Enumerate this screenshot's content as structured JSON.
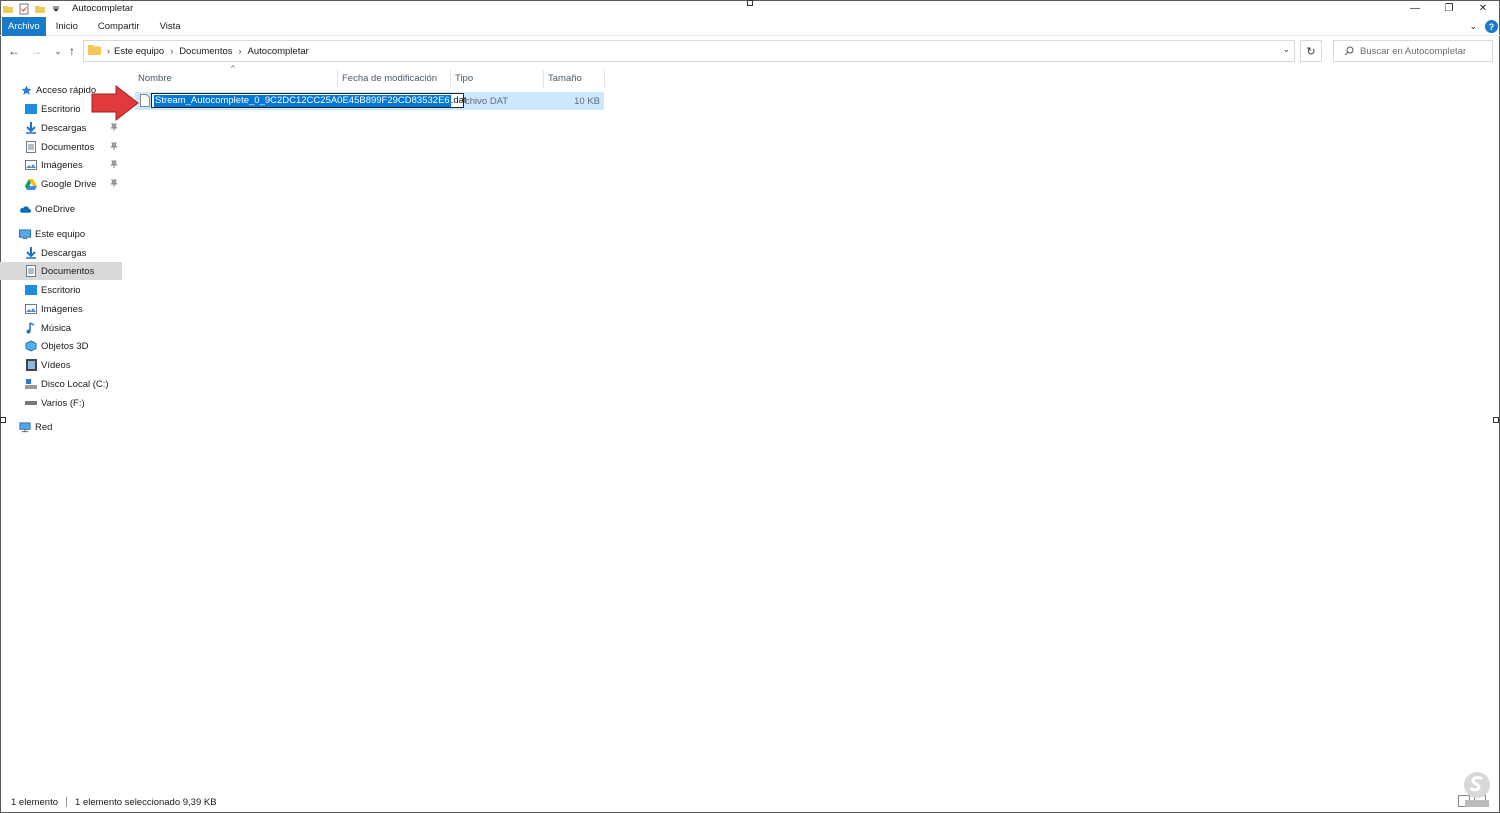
{
  "window": {
    "title": "Autocompletar",
    "controls": {
      "minimize": "—",
      "restore": "❐",
      "close": "✕"
    }
  },
  "ribbon": {
    "tabs": [
      "Archivo",
      "Inicio",
      "Compartir",
      "Vista"
    ],
    "help": "?"
  },
  "address": {
    "crumbs": [
      "Este equipo",
      "Documentos",
      "Autocompletar"
    ]
  },
  "search": {
    "placeholder": "Buscar en Autocompletar"
  },
  "nav_pane": {
    "quick_access": {
      "label": "Acceso rápido",
      "items": [
        "Escritorio",
        "Descargas",
        "Documentos",
        "Imágenes",
        "Google Drive"
      ]
    },
    "onedrive": "OneDrive",
    "this_pc": {
      "label": "Este equipo",
      "items": [
        "Descargas",
        "Documentos",
        "Escritorio",
        "Imágenes",
        "Música",
        "Objetos 3D",
        "Vídeos",
        "Disco Local (C:)",
        "Varios (F:)"
      ]
    },
    "network": "Red"
  },
  "columns": [
    "Nombre",
    "Fecha de modificación",
    "Tipo",
    "Tamaño"
  ],
  "file": {
    "name_selected": "Stream_Autocomplete_0_9C2DC12CC25A0E45B899F29CD83532E6",
    "name_ext": ".dat",
    "type": "chivo DAT",
    "size": "10 KB"
  },
  "status": {
    "count": "1 elemento",
    "selection": "1 elemento seleccionado  9,39 KB"
  },
  "colors": {
    "accent": "#1979ca",
    "selection_row": "#cce8ff",
    "text_selection": "#0078d7",
    "arrow": "#e03a3a"
  }
}
